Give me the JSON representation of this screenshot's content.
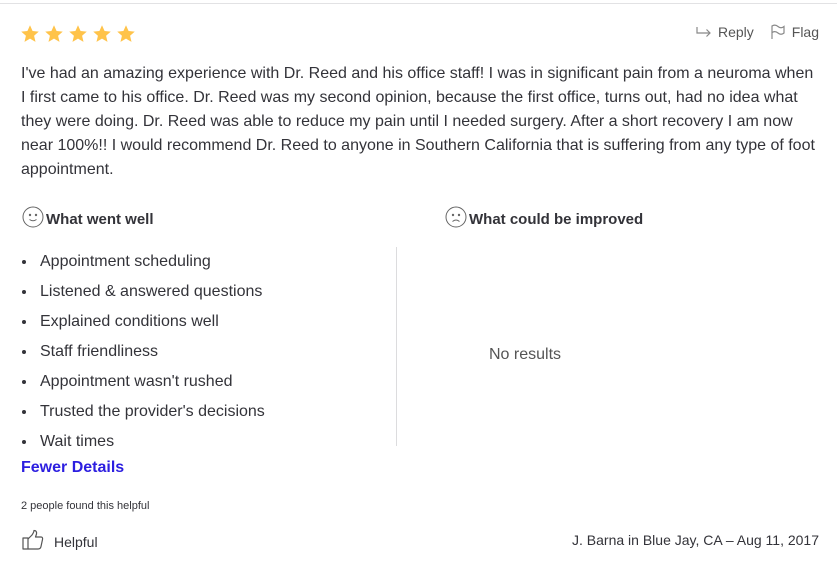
{
  "review": {
    "rating": 5,
    "max_rating": 5,
    "star_color": "#ffc34a",
    "text": "I've had an amazing experience with Dr. Reed and his office staff! I was in significant pain from a neuroma when I first came to his office. Dr. Reed was my second opinion, because the first office, turns out, had no idea what they were doing. Dr. Reed was able to reduce my pain until I needed surgery. After a short recovery I am now near 100%!! I would recommend Dr. Reed to anyone in Southern California that is suffering from any type of foot appointment.",
    "author_line": "J. Barna in Blue Jay, CA – Aug 11, 2017"
  },
  "actions": {
    "reply_label": "Reply",
    "reply_icon": "reply-arrow-icon",
    "flag_label": "Flag",
    "flag_icon": "flag-icon"
  },
  "went_well": {
    "heading": "What went well",
    "icon": "smiley-face-icon",
    "items": [
      "Appointment scheduling",
      "Listened & answered questions",
      "Explained conditions well",
      "Staff friendliness",
      "Appointment wasn't rushed",
      "Trusted the provider's decisions",
      "Wait times"
    ]
  },
  "could_improve": {
    "heading": "What could be improved",
    "icon": "sad-face-icon",
    "empty_text": "No results"
  },
  "toggle": {
    "fewer_details_label": "Fewer Details",
    "link_color": "#2c1ee0"
  },
  "helpful": {
    "count_text": "2 people found this helpful",
    "button_label": "Helpful",
    "icon": "thumbs-up-icon"
  }
}
